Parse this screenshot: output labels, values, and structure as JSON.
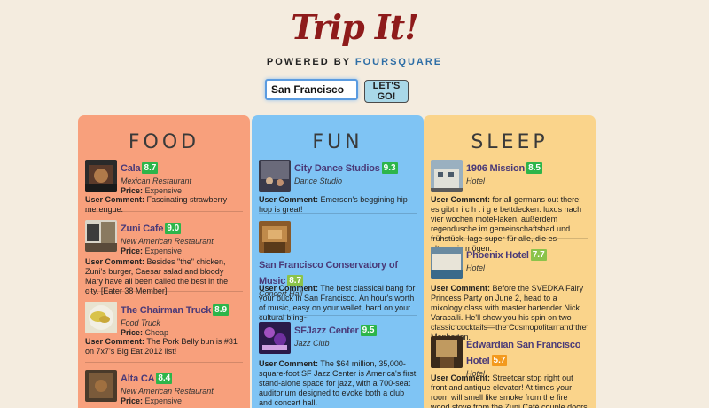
{
  "app": {
    "logo": "Trip It!",
    "powered_prefix": "POWERED BY",
    "powered_brand": "FOURSQUARE"
  },
  "search": {
    "value": "San Francisco",
    "button_label": "LET'S GO!"
  },
  "colors": {
    "food": "#f8a07c",
    "fun": "#7fc4f4",
    "sleep": "#fad48b",
    "score_green": "#2db54a",
    "score_lime": "#8bc34a",
    "score_orange": "#f39a1e"
  },
  "columns": {
    "food": {
      "title": "FOOD",
      "items": [
        {
          "name": "Cala",
          "score": "8.7",
          "category": "Mexican Restaurant",
          "price_label": "Price:",
          "price": "Expensive",
          "comment_label": "User Comment:",
          "comment": "Fascinating strawberry merengue."
        },
        {
          "name": "Zuni Cafe",
          "score": "9.0",
          "category": "New American Restaurant",
          "price_label": "Price:",
          "price": "Expensive",
          "comment_label": "User Comment:",
          "comment": "Besides \"the\" chicken, Zuni's burger, Caesar salad and bloody Mary have all been called the best in the city. [Eater 38 Member]"
        },
        {
          "name": "The Chairman Truck",
          "score": "8.9",
          "category": "Food Truck",
          "price_label": "Price:",
          "price": "Cheap",
          "comment_label": "User Comment:",
          "comment": "The Pork Belly bun is #31 on 7x7's Big Eat 2012 list!"
        },
        {
          "name": "Alta CA",
          "score": "8.4",
          "category": "New American Restaurant",
          "price_label": "Price:",
          "price": "Expensive"
        }
      ]
    },
    "fun": {
      "title": "FUN",
      "items": [
        {
          "name": "City Dance Studios",
          "score": "9.3",
          "category": "Dance Studio",
          "comment_label": "User Comment:",
          "comment": "Emerson's beggining hip hop is great!"
        },
        {
          "name": "San Francisco Conservatory of Music",
          "score": "8.7",
          "category": "Concert Hall",
          "comment_label": "User Comment:",
          "comment": "The best classical bang for your buck in San Francisco. An hour's worth of music, easy on your wallet, hard on your cultural bling~"
        },
        {
          "name": "SFJazz Center",
          "score": "9.5",
          "category": "Jazz Club",
          "comment_label": "User Comment:",
          "comment": "The $64 million, 35,000-square-foot SF Jazz Center is America's first stand-alone space for jazz, with a 700-seat auditorium designed to evoke both a club and concert hall."
        }
      ]
    },
    "sleep": {
      "title": "SLEEP",
      "items": [
        {
          "name": "1906 Mission",
          "score": "8.5",
          "category": "Hotel",
          "comment_label": "User Comment:",
          "comment": "for all germans out there: es gibt r i c h t i g e bettdecken. luxus nach vier wochen motel-laken. außerdem regendusche im gemeinschaftsbad und frühstück. lage super für alle, die es alternativ mögen."
        },
        {
          "name": "Phoenix Hotel",
          "score": "7.7",
          "category": "Hotel",
          "comment_label": "User Comment:",
          "comment": "Before the SVEDKA Fairy Princess Party on June 2, head to a mixology class with master bartender Nick Varacalli. He'll show you his spin on two classic cocktails—the Cosmopolitan and the Manhattan."
        },
        {
          "name": "Edwardian San Francisco Hotel",
          "score": "5.7",
          "category": "Hotel",
          "comment_label": "User Comment:",
          "comment": "Streetcar stop right out front and antique elevator! At times your room will smell like smoke from the fire wood stove from the Zuni Café couple doors"
        }
      ]
    }
  }
}
